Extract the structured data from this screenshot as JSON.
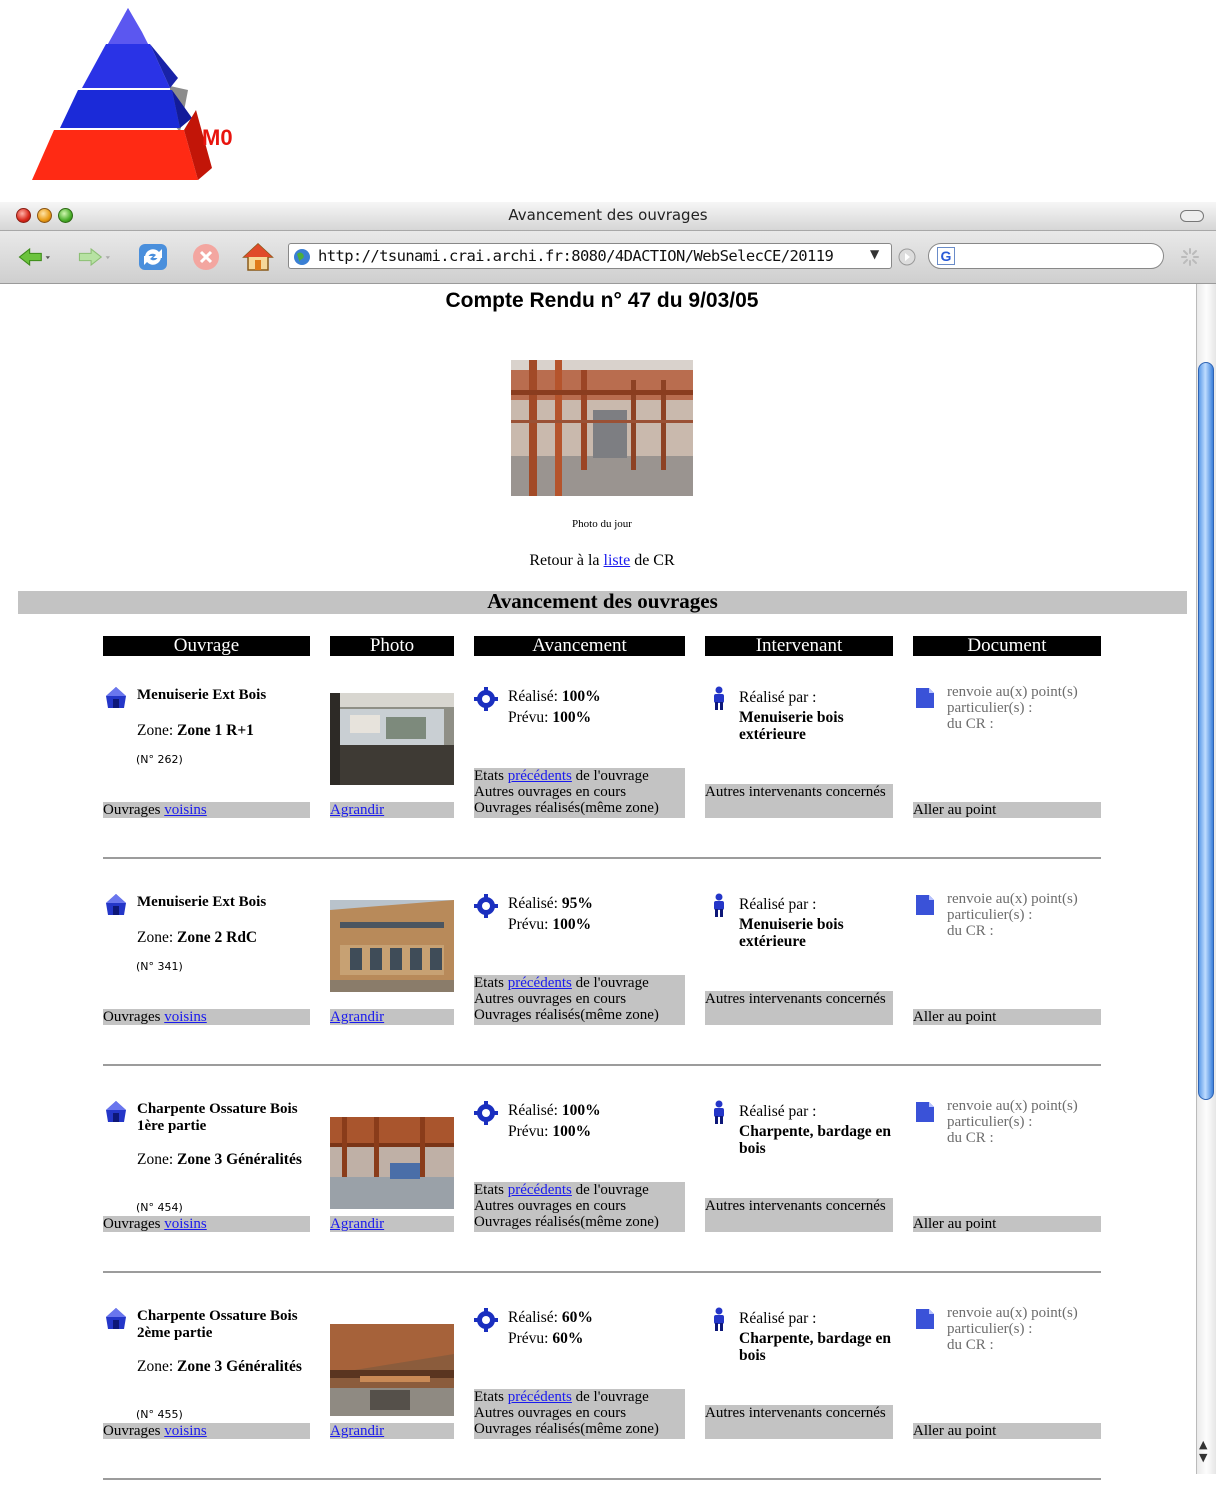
{
  "logo": {
    "text": "M0"
  },
  "window": {
    "title": "Avancement des ouvrages"
  },
  "toolbar": {
    "url": "http://tsunami.crai.archi.fr:8080/4DACTION/WebSelecCE/20119"
  },
  "page": {
    "title": "Compte Rendu n° 47 du 9/03/05",
    "photo_caption": "Photo du jour",
    "retour_prefix": "Retour à la",
    "retour_link": "liste",
    "retour_suffix": "de CR",
    "section_title": "Avancement des ouvrages"
  },
  "columns": [
    "Ouvrage",
    "Photo",
    "Avancement",
    "Intervenant",
    "Document"
  ],
  "labels": {
    "zone": "Zone:",
    "ouvrages": "Ouvrages",
    "voisins": "voisins",
    "agrandir": "Agrandir",
    "realise": "Réalisé:",
    "prevu": "Prévu:",
    "etats": "Etats",
    "precedents": "précédents",
    "de_ouvrage": "de l'ouvrage",
    "autres_en_cours": "Autres ouvrages en cours",
    "realises_zone": "Ouvrages réalisés(même zone)",
    "realise_par": "Réalisé par :",
    "autres_intervenants": "Autres intervenants concernés",
    "doc_text_1": "renvoie au(x) point(s)",
    "doc_text_2": "particulier(s) :",
    "doc_text_3": "du CR :",
    "aller_point": "Aller au point"
  },
  "rows": [
    {
      "ouvrage": "Menuiserie Ext Bois",
      "zone": "Zone 1 R+1",
      "num": "(N° 262)",
      "realise": "100%",
      "prevu": "100%",
      "intervenant": "Menuiserie bois extérieure"
    },
    {
      "ouvrage": "Menuiserie Ext Bois",
      "zone": "Zone 2 RdC",
      "num": "(N° 341)",
      "realise": "95%",
      "prevu": "100%",
      "intervenant": "Menuiserie bois extérieure"
    },
    {
      "ouvrage": "Charpente Ossature Bois 1ère partie",
      "zone": "Zone 3 Généralités",
      "num": "(N° 454)",
      "realise": "100%",
      "prevu": "100%",
      "intervenant": "Charpente, bardage en bois"
    },
    {
      "ouvrage": "Charpente Ossature Bois 2ème partie",
      "zone": "Zone 3 Généralités",
      "num": "(N° 455)",
      "realise": "60%",
      "prevu": "60%",
      "intervenant": "Charpente, bardage en bois"
    }
  ]
}
